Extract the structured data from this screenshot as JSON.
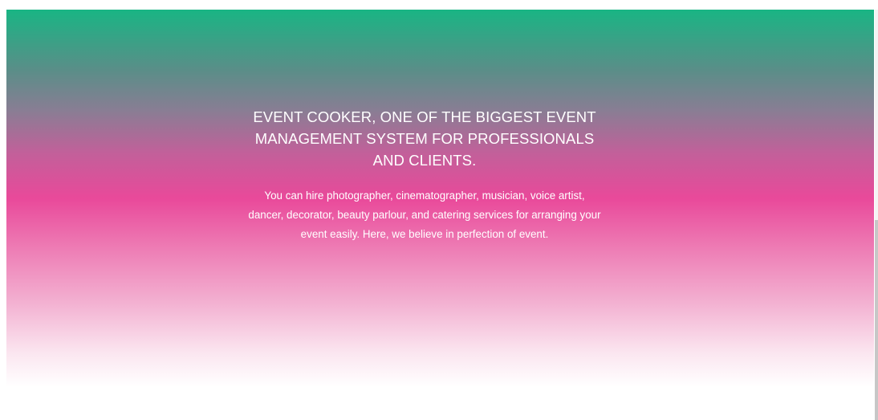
{
  "hero": {
    "title": "EVENT COOKER, ONE OF THE BIGGEST EVENT MANAGEMENT SYSTEM FOR PROFESSIONALS AND CLIENTS.",
    "description": "You can hire photographer, cinematographer, musician, voice artist, dancer, decorator, beauty parlour, and catering services for arranging your event easily. Here, we believe in perfection of event.",
    "gradient_colors": [
      "#19b584",
      "#e9499a",
      "#ffffff"
    ],
    "text_color": "#ffffff"
  }
}
